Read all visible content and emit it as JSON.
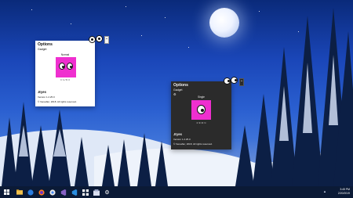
{
  "colors": {
    "accent": "#ef2fcf",
    "taskbar": "#0b1a36"
  },
  "light_widget": {
    "title": "Options",
    "section": "Gadget",
    "style": "Normal",
    "controls": "I<  1 / 6  >I",
    "app_name": ".Eyes",
    "version": "Version 1.2.25.0",
    "copyright": "© Vereafter, 2018. All rights reserved."
  },
  "dark_widget": {
    "title": "Options",
    "section": "Gadget",
    "style": "Single",
    "controls": "I<  3 / 6  >I",
    "app_name": ".Eyes",
    "version": "Version 1.2.25.0",
    "copyright": "© Vereafter, 2018. All rights reserved."
  },
  "taskbar": {
    "icons": [
      "windows-start-icon",
      "search-icon",
      "file-explorer-icon",
      "firefox-icon",
      "chrome-icon",
      "visual-studio-icon",
      "task-view-icon",
      "store-icon",
      "settings-icon"
    ],
    "time": "3:45 PM",
    "date": "2/20/2019"
  }
}
